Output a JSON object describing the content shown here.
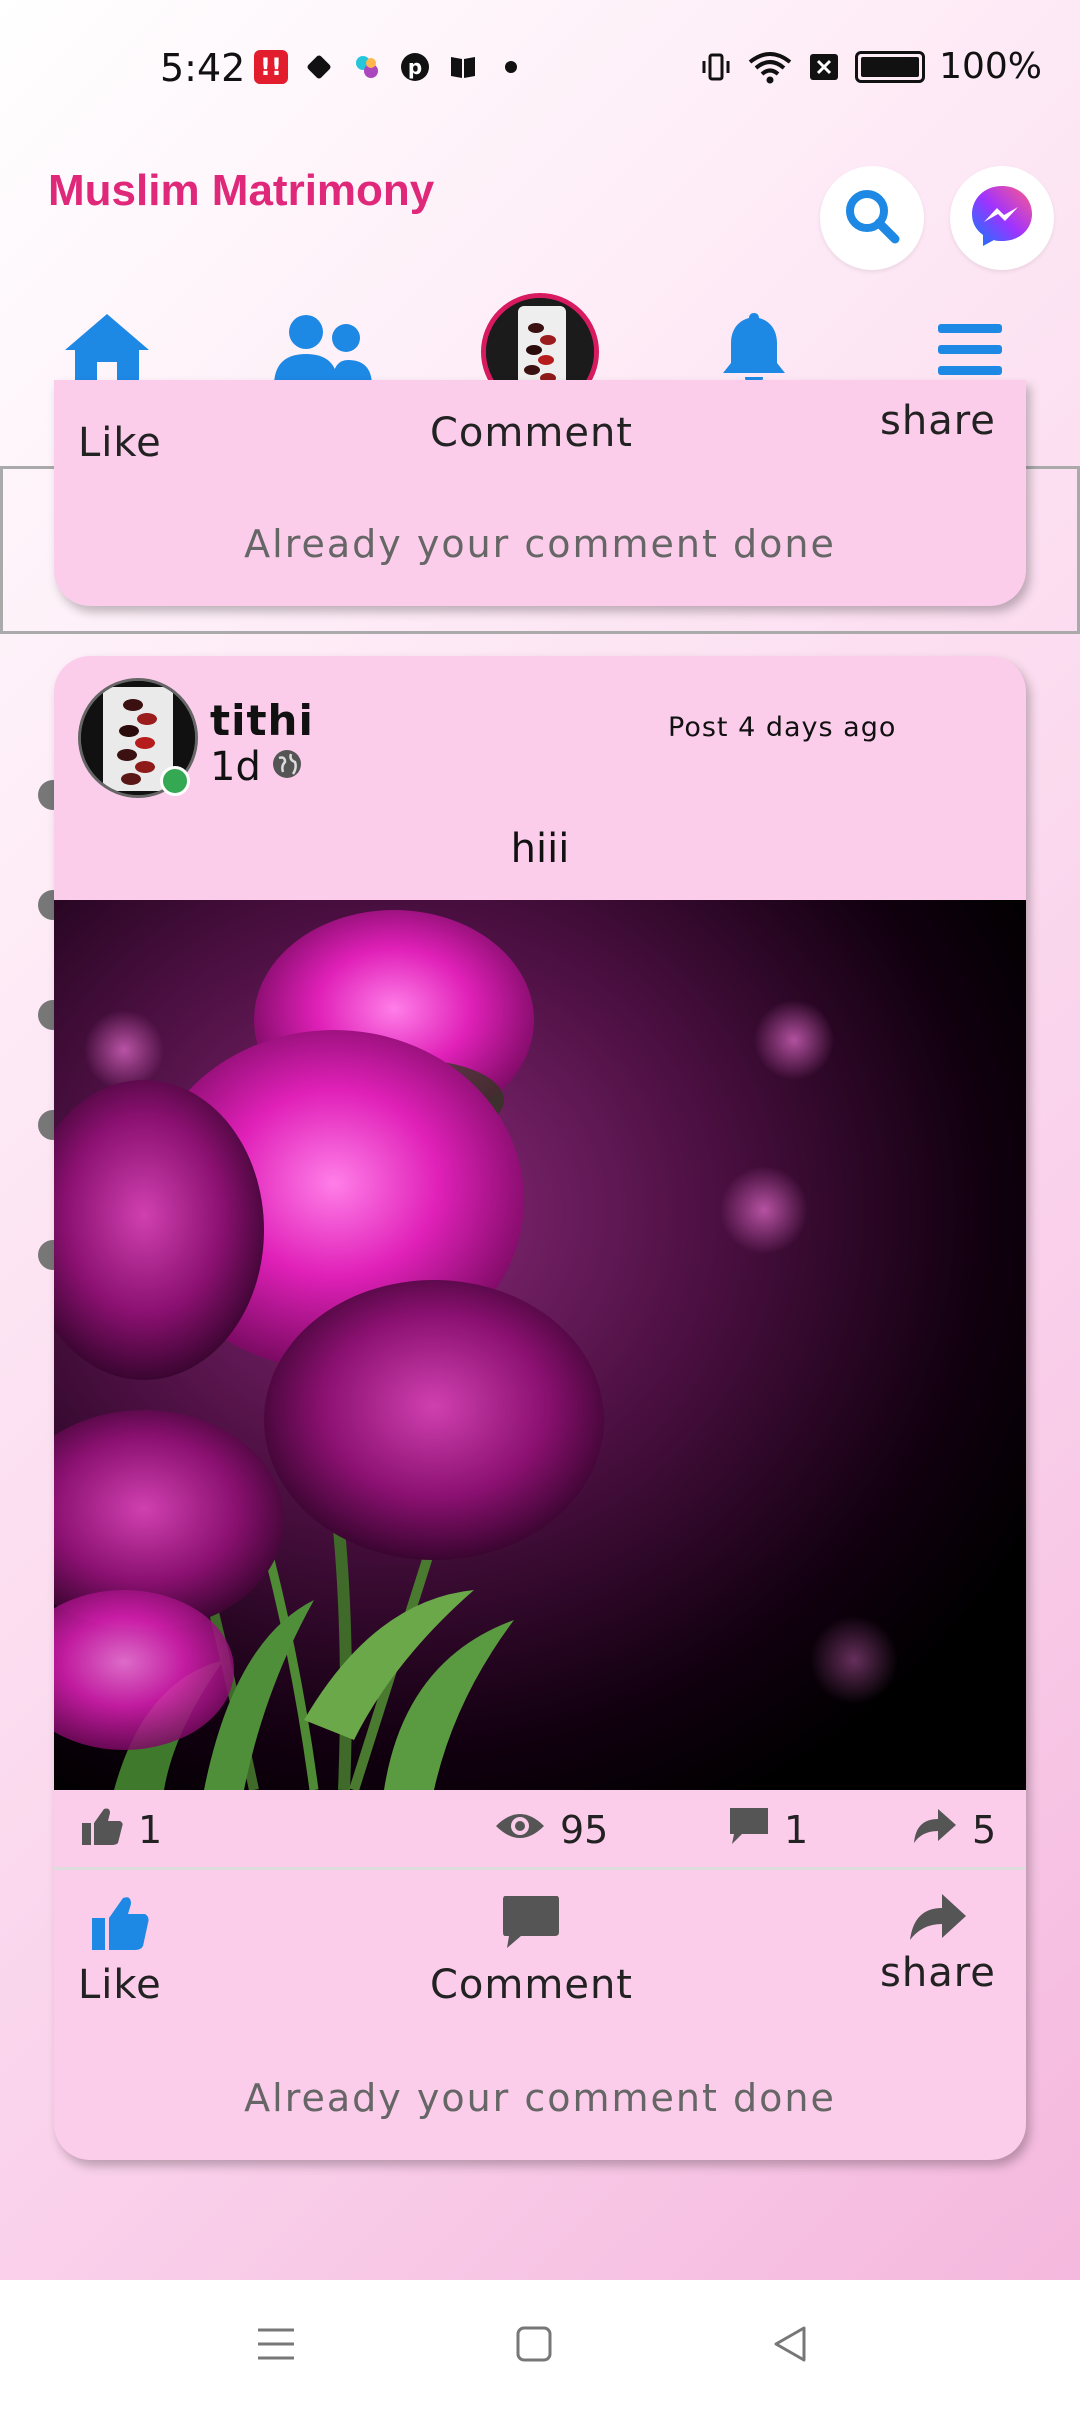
{
  "status": {
    "time": "5:42",
    "battery": "100%",
    "left_icons": [
      "app-notification-icon",
      "puzzle-icon",
      "pinwheel-icon",
      "pinterest-icon",
      "book-icon",
      "dot-icon"
    ],
    "right_icons": [
      "vibrate-icon",
      "wifi-icon",
      "no-sim-icon",
      "battery-icon"
    ]
  },
  "header": {
    "title": "Muslim Matrimony"
  },
  "nav": {
    "items": [
      "home",
      "friends",
      "profile",
      "notifications",
      "menu"
    ],
    "active": "profile",
    "accent": "#1e88e5",
    "active_color": "#d81b60"
  },
  "prev_post": {
    "like_label": "Like",
    "comment_label": "Comment",
    "share_label": "share",
    "comment_status": "Already your comment done"
  },
  "post": {
    "author": "tithi",
    "age": "1d",
    "posted": "Post 4 days ago",
    "text": "hiii",
    "stats": {
      "likes": "1",
      "views": "95",
      "comments": "1",
      "shares": "5"
    },
    "like_label": "Like",
    "comment_label": "Comment",
    "share_label": "share",
    "comment_status": "Already your comment done"
  },
  "colors": {
    "brand": "#e0287a",
    "card": "#fccdeb",
    "like_blue": "#1e88e5",
    "online": "#34a853"
  }
}
